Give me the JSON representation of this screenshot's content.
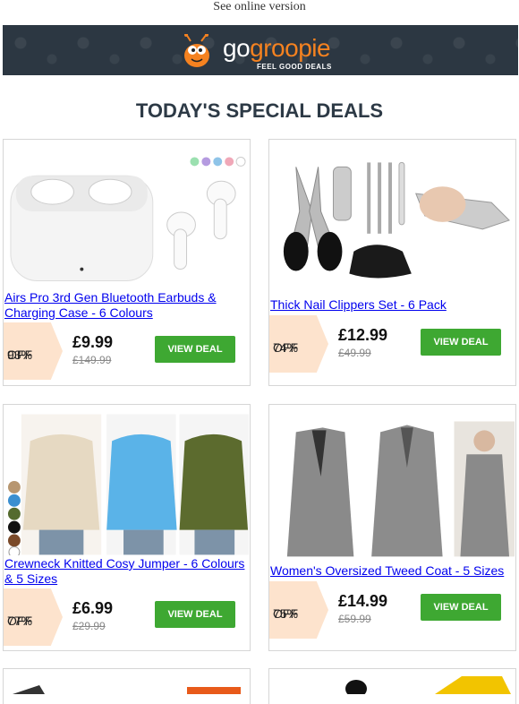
{
  "header": {
    "online_link": "See online version"
  },
  "brand": {
    "name_a": "go",
    "name_b": "groopie",
    "tagline": "FEEL GOOD DEALS",
    "accent": "#f58220",
    "banner_bg": "#2c3742"
  },
  "section": {
    "title": "TODAY'S SPECIAL DEALS"
  },
  "deals": [
    {
      "title": "Airs Pro 3rd Gen Bluetooth Earbuds & Charging Case - 6 Colours",
      "discount": "93%",
      "off": "OFF",
      "price": "£9.99",
      "was": "£149.99",
      "cta": "VIEW DEAL"
    },
    {
      "title": "Thick Nail Clippers Set - 6 Pack",
      "discount": "74%",
      "off": "OFF",
      "price": "£12.99",
      "was": "£49.99",
      "cta": "VIEW DEAL"
    },
    {
      "title": "Crewneck Knitted Cosy Jumper - 6 Colours & 5 Sizes",
      "discount": "77%",
      "off": "OFF",
      "price": "£6.99",
      "was": "£29.99",
      "cta": "VIEW DEAL"
    },
    {
      "title": "Women's Oversized Tweed Coat - 5 Sizes",
      "discount": "75%",
      "off": "OFF",
      "price": "£14.99",
      "was": "£59.99",
      "cta": "VIEW DEAL"
    }
  ],
  "colors": {
    "button": "#3ea832",
    "badge": "#fde3cd",
    "heading": "#2d3a46"
  }
}
